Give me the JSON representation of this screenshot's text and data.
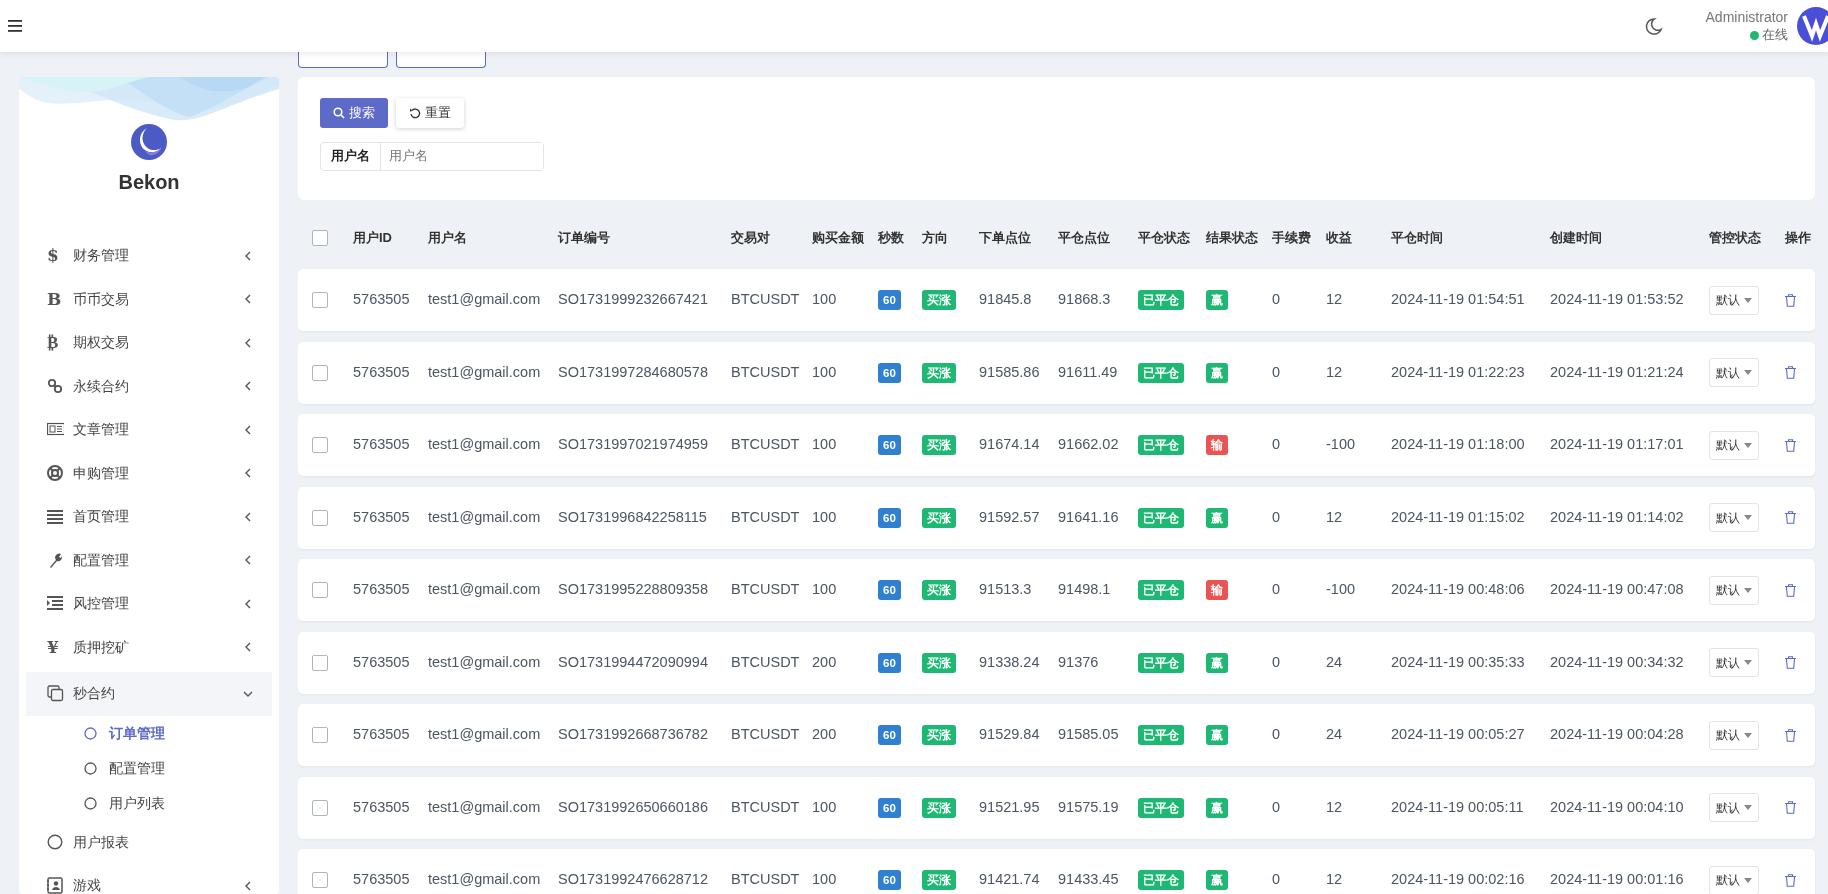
{
  "header": {
    "user_name": "Administrator",
    "status": {
      "text": "在线",
      "color": "#1eb874"
    }
  },
  "brand": {
    "name": "Bekon"
  },
  "sidebar": {
    "items": [
      {
        "icon_text": "$",
        "label": "财务管理",
        "expanded": false
      },
      {
        "icon_text": "B",
        "label": "币币交易",
        "expanded": false
      },
      {
        "icon_text": "₿",
        "label": "期权交易",
        "expanded": false
      },
      {
        "label": "永续合约",
        "expanded": false
      },
      {
        "label": "文章管理",
        "expanded": false
      },
      {
        "label": "申购管理",
        "expanded": false
      },
      {
        "label": "首页管理",
        "expanded": false
      },
      {
        "label": "配置管理",
        "expanded": false
      },
      {
        "label": "风控管理",
        "expanded": false
      },
      {
        "icon_text": "¥",
        "label": "质押挖矿",
        "expanded": false
      },
      {
        "label": "秒合约",
        "expanded": true,
        "children": [
          {
            "label": "订单管理",
            "selected": true
          },
          {
            "label": "配置管理",
            "selected": false
          },
          {
            "label": "用户列表",
            "selected": false
          }
        ]
      },
      {
        "label": "用户报表"
      },
      {
        "label": "游戏",
        "expanded": false
      }
    ]
  },
  "search": {
    "search_button": "搜索",
    "reset_button": "重置",
    "field_label": "用户名",
    "placeholder": "用户名"
  },
  "table": {
    "select_all_checked": false,
    "columns": [
      "用户ID",
      "用户名",
      "订单编号",
      "交易对",
      "购买金额",
      "秒数",
      "方向",
      "下单点位",
      "平仓点位",
      "平仓状态",
      "结果状态",
      "手续费",
      "收益",
      "平仓时间",
      "创建时间",
      "管控状态",
      "操作"
    ],
    "rows": [
      {
        "checked": false,
        "user_id": "5763505",
        "username": "test1@gmail.com",
        "order_no": "SO1731999232667421",
        "pair": "BTCUSDT",
        "amount": "100",
        "seconds": "60",
        "direction": "买涨",
        "open_price": "91845.8",
        "close_price": "91868.3",
        "close_status": "已平仓",
        "result": {
          "text": "赢",
          "color": "#1eb874"
        },
        "fee": "0",
        "profit": "12",
        "close_time": "2024-11-19 01:54:51",
        "create_time": "2024-11-19 01:53:52",
        "control": "默认"
      },
      {
        "checked": false,
        "user_id": "5763505",
        "username": "test1@gmail.com",
        "order_no": "SO1731997284680578",
        "pair": "BTCUSDT",
        "amount": "100",
        "seconds": "60",
        "direction": "买涨",
        "open_price": "91585.86",
        "close_price": "91611.49",
        "close_status": "已平仓",
        "result": {
          "text": "赢",
          "color": "#1eb874"
        },
        "fee": "0",
        "profit": "12",
        "close_time": "2024-11-19 01:22:23",
        "create_time": "2024-11-19 01:21:24",
        "control": "默认"
      },
      {
        "checked": false,
        "user_id": "5763505",
        "username": "test1@gmail.com",
        "order_no": "SO1731997021974959",
        "pair": "BTCUSDT",
        "amount": "100",
        "seconds": "60",
        "direction": "买涨",
        "open_price": "91674.14",
        "close_price": "91662.02",
        "close_status": "已平仓",
        "result": {
          "text": "输",
          "color": "#e85454"
        },
        "fee": "0",
        "profit": "-100",
        "close_time": "2024-11-19 01:18:00",
        "create_time": "2024-11-19 01:17:01",
        "control": "默认"
      },
      {
        "checked": false,
        "user_id": "5763505",
        "username": "test1@gmail.com",
        "order_no": "SO1731996842258115",
        "pair": "BTCUSDT",
        "amount": "100",
        "seconds": "60",
        "direction": "买涨",
        "open_price": "91592.57",
        "close_price": "91641.16",
        "close_status": "已平仓",
        "result": {
          "text": "赢",
          "color": "#1eb874"
        },
        "fee": "0",
        "profit": "12",
        "close_time": "2024-11-19 01:15:02",
        "create_time": "2024-11-19 01:14:02",
        "control": "默认"
      },
      {
        "checked": false,
        "user_id": "5763505",
        "username": "test1@gmail.com",
        "order_no": "SO1731995228809358",
        "pair": "BTCUSDT",
        "amount": "100",
        "seconds": "60",
        "direction": "买涨",
        "open_price": "91513.3",
        "close_price": "91498.1",
        "close_status": "已平仓",
        "result": {
          "text": "输",
          "color": "#e85454"
        },
        "fee": "0",
        "profit": "-100",
        "close_time": "2024-11-19 00:48:06",
        "create_time": "2024-11-19 00:47:08",
        "control": "默认"
      },
      {
        "checked": false,
        "user_id": "5763505",
        "username": "test1@gmail.com",
        "order_no": "SO1731994472090994",
        "pair": "BTCUSDT",
        "amount": "200",
        "seconds": "60",
        "direction": "买涨",
        "open_price": "91338.24",
        "close_price": "91376",
        "close_status": "已平仓",
        "result": {
          "text": "赢",
          "color": "#1eb874"
        },
        "fee": "0",
        "profit": "24",
        "close_time": "2024-11-19 00:35:33",
        "create_time": "2024-11-19 00:34:32",
        "control": "默认"
      },
      {
        "checked": false,
        "user_id": "5763505",
        "username": "test1@gmail.com",
        "order_no": "SO1731992668736782",
        "pair": "BTCUSDT",
        "amount": "200",
        "seconds": "60",
        "direction": "买涨",
        "open_price": "91529.84",
        "close_price": "91585.05",
        "close_status": "已平仓",
        "result": {
          "text": "赢",
          "color": "#1eb874"
        },
        "fee": "0",
        "profit": "24",
        "close_time": "2024-11-19 00:05:27",
        "create_time": "2024-11-19 00:04:28",
        "control": "默认"
      },
      {
        "checked": false,
        "user_id": "5763505",
        "username": "test1@gmail.com",
        "order_no": "SO1731992650660186",
        "pair": "BTCUSDT",
        "amount": "100",
        "seconds": "60",
        "direction": "买涨",
        "open_price": "91521.95",
        "close_price": "91575.19",
        "close_status": "已平仓",
        "result": {
          "text": "赢",
          "color": "#1eb874"
        },
        "fee": "0",
        "profit": "12",
        "close_time": "2024-11-19 00:05:11",
        "create_time": "2024-11-19 00:04:10",
        "control": "默认"
      },
      {
        "checked": false,
        "user_id": "5763505",
        "username": "test1@gmail.com",
        "order_no": "SO1731992476628712",
        "pair": "BTCUSDT",
        "amount": "100",
        "seconds": "60",
        "direction": "买涨",
        "open_price": "91421.74",
        "close_price": "91433.45",
        "close_status": "已平仓",
        "result": {
          "text": "赢",
          "color": "#1eb874"
        },
        "fee": "0",
        "profit": "12",
        "close_time": "2024-11-19 00:02:16",
        "create_time": "2024-11-19 00:01:16",
        "control": "默认"
      }
    ]
  }
}
